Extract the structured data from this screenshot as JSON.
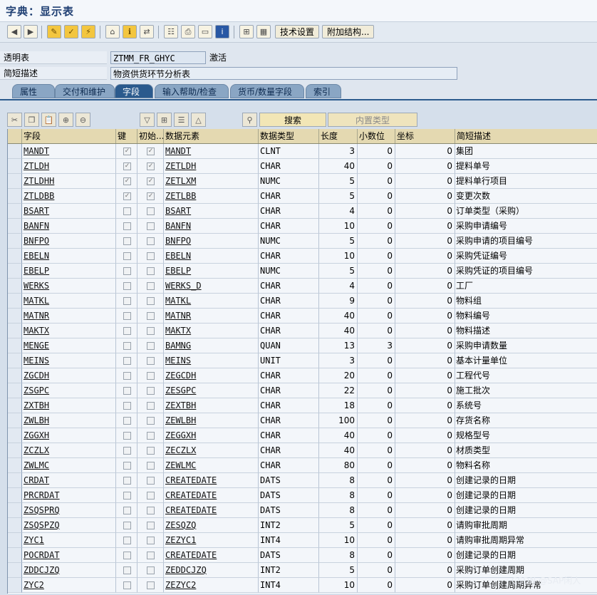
{
  "window": {
    "title": "字典：显示表"
  },
  "toolbar": {
    "tech_settings_label": "技术设置",
    "append_structure_label": "附加结构..."
  },
  "header": {
    "table_label": "透明表",
    "table_value": "ZTMM_FR_GHYC",
    "table_status": "激活",
    "desc_label": "简短描述",
    "desc_value": "物资供货环节分析表"
  },
  "tabs": [
    {
      "label": "属性"
    },
    {
      "label": "交付和维护"
    },
    {
      "label": "字段"
    },
    {
      "label": "输入帮助/检查"
    },
    {
      "label": "货币/数量字段"
    },
    {
      "label": "索引"
    }
  ],
  "field_toolbar": {
    "search_label": "搜索",
    "builtin_type_label": "内置类型"
  },
  "columns": {
    "field": "字段",
    "key": "键",
    "init": "初始...",
    "data_element": "数据元素",
    "data_type": "数据类型",
    "length": "长度",
    "decimals": "小数位",
    "coord": "坐标",
    "short_desc": "简短描述"
  },
  "rows": [
    {
      "field": "MANDT",
      "key": true,
      "init": true,
      "element": "MANDT",
      "type": "CLNT",
      "length": "3",
      "decimals": "0",
      "coord": "0",
      "desc": "集团"
    },
    {
      "field": "ZTLDH",
      "key": true,
      "init": true,
      "element": "ZETLDH",
      "type": "CHAR",
      "length": "40",
      "decimals": "0",
      "coord": "0",
      "desc": "提料单号"
    },
    {
      "field": "ZTLDHH",
      "key": true,
      "init": true,
      "element": "ZETLXM",
      "type": "NUMC",
      "length": "5",
      "decimals": "0",
      "coord": "0",
      "desc": "提料单行项目"
    },
    {
      "field": "ZTLDBB",
      "key": true,
      "init": true,
      "element": "ZETLBB",
      "type": "CHAR",
      "length": "5",
      "decimals": "0",
      "coord": "0",
      "desc": "变更次数"
    },
    {
      "field": "BSART",
      "key": false,
      "init": false,
      "element": "BSART",
      "type": "CHAR",
      "length": "4",
      "decimals": "0",
      "coord": "0",
      "desc": "订单类型（采购）"
    },
    {
      "field": "BANFN",
      "key": false,
      "init": false,
      "element": "BANFN",
      "type": "CHAR",
      "length": "10",
      "decimals": "0",
      "coord": "0",
      "desc": "采购申请编号"
    },
    {
      "field": "BNFPO",
      "key": false,
      "init": false,
      "element": "BNFPO",
      "type": "NUMC",
      "length": "5",
      "decimals": "0",
      "coord": "0",
      "desc": "采购申请的项目编号"
    },
    {
      "field": "EBELN",
      "key": false,
      "init": false,
      "element": "EBELN",
      "type": "CHAR",
      "length": "10",
      "decimals": "0",
      "coord": "0",
      "desc": "采购凭证编号"
    },
    {
      "field": "EBELP",
      "key": false,
      "init": false,
      "element": "EBELP",
      "type": "NUMC",
      "length": "5",
      "decimals": "0",
      "coord": "0",
      "desc": "采购凭证的项目编号"
    },
    {
      "field": "WERKS",
      "key": false,
      "init": false,
      "element": "WERKS_D",
      "type": "CHAR",
      "length": "4",
      "decimals": "0",
      "coord": "0",
      "desc": "工厂"
    },
    {
      "field": "MATKL",
      "key": false,
      "init": false,
      "element": "MATKL",
      "type": "CHAR",
      "length": "9",
      "decimals": "0",
      "coord": "0",
      "desc": "物料组"
    },
    {
      "field": "MATNR",
      "key": false,
      "init": false,
      "element": "MATNR",
      "type": "CHAR",
      "length": "40",
      "decimals": "0",
      "coord": "0",
      "desc": "物料编号"
    },
    {
      "field": "MAKTX",
      "key": false,
      "init": false,
      "element": "MAKTX",
      "type": "CHAR",
      "length": "40",
      "decimals": "0",
      "coord": "0",
      "desc": "物料描述"
    },
    {
      "field": "MENGE",
      "key": false,
      "init": false,
      "element": "BAMNG",
      "type": "QUAN",
      "length": "13",
      "decimals": "3",
      "coord": "0",
      "desc": "采购申请数量"
    },
    {
      "field": "MEINS",
      "key": false,
      "init": false,
      "element": "MEINS",
      "type": "UNIT",
      "length": "3",
      "decimals": "0",
      "coord": "0",
      "desc": "基本计量单位"
    },
    {
      "field": "ZGCDH",
      "key": false,
      "init": false,
      "element": "ZEGCDH",
      "type": "CHAR",
      "length": "20",
      "decimals": "0",
      "coord": "0",
      "desc": "工程代号"
    },
    {
      "field": "ZSGPC",
      "key": false,
      "init": false,
      "element": "ZESGPC",
      "type": "CHAR",
      "length": "22",
      "decimals": "0",
      "coord": "0",
      "desc": "施工批次"
    },
    {
      "field": "ZXTBH",
      "key": false,
      "init": false,
      "element": "ZEXTBH",
      "type": "CHAR",
      "length": "18",
      "decimals": "0",
      "coord": "0",
      "desc": "系统号"
    },
    {
      "field": "ZWLBH",
      "key": false,
      "init": false,
      "element": "ZEWLBH",
      "type": "CHAR",
      "length": "100",
      "decimals": "0",
      "coord": "0",
      "desc": "存货名称"
    },
    {
      "field": "ZGGXH",
      "key": false,
      "init": false,
      "element": "ZEGGXH",
      "type": "CHAR",
      "length": "40",
      "decimals": "0",
      "coord": "0",
      "desc": "规格型号"
    },
    {
      "field": "ZCZLX",
      "key": false,
      "init": false,
      "element": "ZECZLX",
      "type": "CHAR",
      "length": "40",
      "decimals": "0",
      "coord": "0",
      "desc": "材质类型"
    },
    {
      "field": "ZWLMC",
      "key": false,
      "init": false,
      "element": "ZEWLMC",
      "type": "CHAR",
      "length": "80",
      "decimals": "0",
      "coord": "0",
      "desc": "物料名称"
    },
    {
      "field": "CRDAT",
      "key": false,
      "init": false,
      "element": "CREATEDATE",
      "type": "DATS",
      "length": "8",
      "decimals": "0",
      "coord": "0",
      "desc": "创建记录的日期"
    },
    {
      "field": "PRCRDAT",
      "key": false,
      "init": false,
      "element": "CREATEDATE",
      "type": "DATS",
      "length": "8",
      "decimals": "0",
      "coord": "0",
      "desc": "创建记录的日期"
    },
    {
      "field": "ZSQSPRQ",
      "key": false,
      "init": false,
      "element": "CREATEDATE",
      "type": "DATS",
      "length": "8",
      "decimals": "0",
      "coord": "0",
      "desc": "创建记录的日期"
    },
    {
      "field": "ZSQSPZQ",
      "key": false,
      "init": false,
      "element": "ZESQZQ",
      "type": "INT2",
      "length": "5",
      "decimals": "0",
      "coord": "0",
      "desc": "请购审批周期"
    },
    {
      "field": "ZYC1",
      "key": false,
      "init": false,
      "element": "ZEZYC1",
      "type": "INT4",
      "length": "10",
      "decimals": "0",
      "coord": "0",
      "desc": "请购审批周期异常"
    },
    {
      "field": "POCRDAT",
      "key": false,
      "init": false,
      "element": "CREATEDATE",
      "type": "DATS",
      "length": "8",
      "decimals": "0",
      "coord": "0",
      "desc": "创建记录的日期"
    },
    {
      "field": "ZDDCJZQ",
      "key": false,
      "init": false,
      "element": "ZEDDCJZQ",
      "type": "INT2",
      "length": "5",
      "decimals": "0",
      "coord": "0",
      "desc": "采购订单创建周期"
    },
    {
      "field": "ZYC2",
      "key": false,
      "init": false,
      "element": "ZEZYC2",
      "type": "INT4",
      "length": "10",
      "decimals": "0",
      "coord": "0",
      "desc": "采购订单创建周期异常"
    }
  ],
  "watermark": "CSDN @SAP闲人"
}
